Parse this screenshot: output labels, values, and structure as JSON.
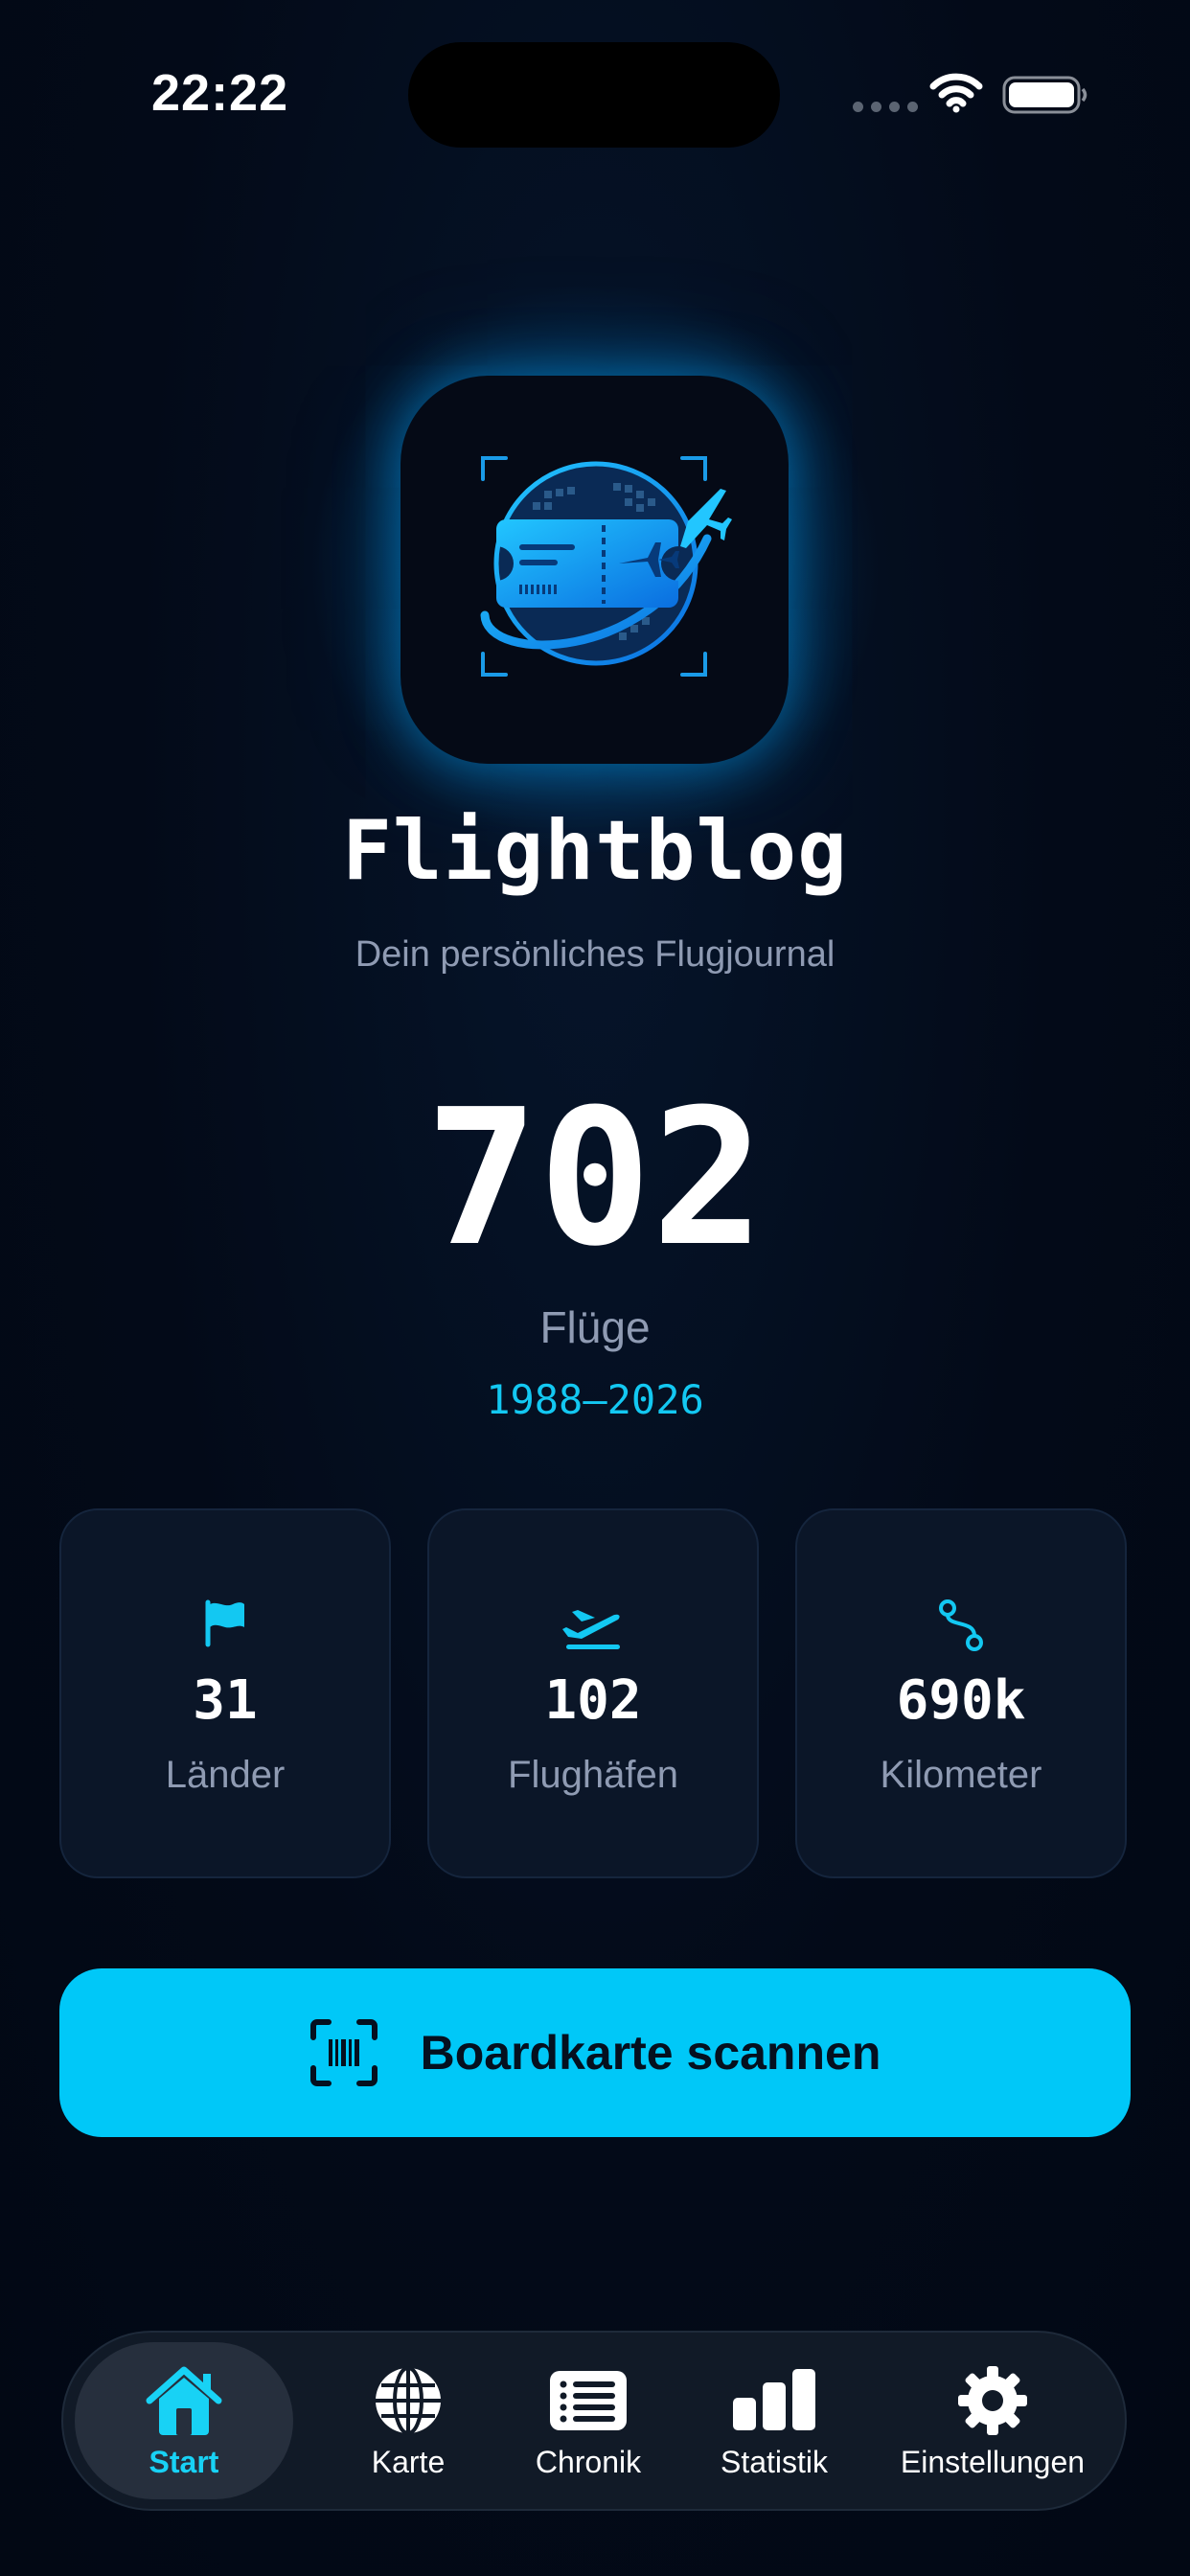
{
  "status_bar": {
    "time": "22:22",
    "icons": [
      "signal-dots-icon",
      "wifi-icon",
      "battery-icon"
    ]
  },
  "app": {
    "name": "Flightblog",
    "tagline": "Dein persönliches Flugjournal",
    "logo_icon": "boarding-pass-globe-plane-icon"
  },
  "summary": {
    "flight_count": "702",
    "flight_label": "Flüge",
    "year_range": "1988–2026"
  },
  "stats": [
    {
      "icon": "flag-icon",
      "value": "31",
      "label": "Länder"
    },
    {
      "icon": "airplane-takeoff-icon",
      "value": "102",
      "label": "Flughäfen"
    },
    {
      "icon": "route-icon",
      "value": "690k",
      "label": "Kilometer"
    }
  ],
  "scan_button": {
    "icon": "barcode-scan-icon",
    "label": "Boardkarte scannen"
  },
  "tab_bar": {
    "active_index": 0,
    "items": [
      {
        "icon": "house-icon",
        "label": "Start"
      },
      {
        "icon": "globe-icon",
        "label": "Karte"
      },
      {
        "icon": "list-icon",
        "label": "Chronik"
      },
      {
        "icon": "bar-chart-icon",
        "label": "Statistik"
      },
      {
        "icon": "gear-icon",
        "label": "Einstellungen"
      }
    ]
  },
  "colors": {
    "background": "#030a18",
    "accent": "#00c8f8",
    "accent_text": "#13c8f2",
    "card_background": "#0b1628",
    "muted_text": "#8f9bb3",
    "tab_bar_background": "#111a27",
    "tab_active_pill": "#262f3d"
  }
}
